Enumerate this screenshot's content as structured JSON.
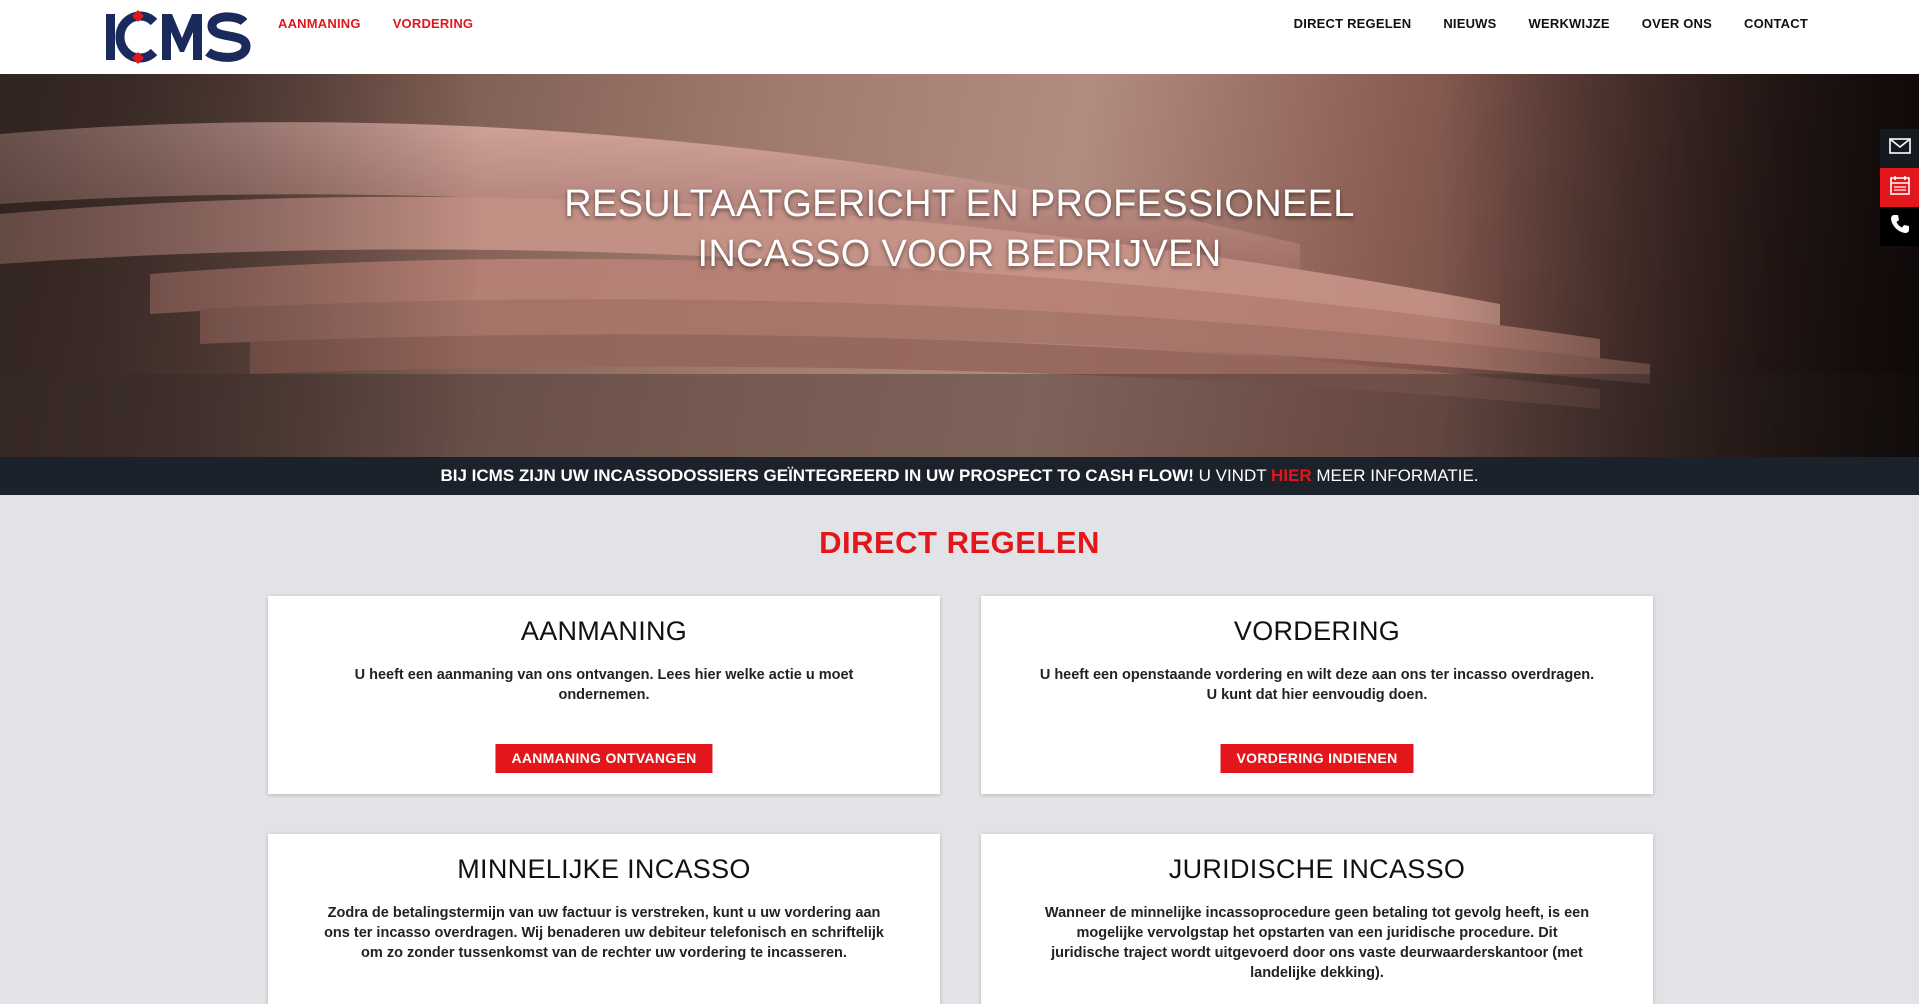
{
  "header": {
    "logo_text": "ICMS",
    "nav_left": [
      "AANMANING",
      "VORDERING"
    ],
    "nav_right": [
      "DIRECT REGELEN",
      "NIEUWS",
      "WERKWIJZE",
      "OVER ONS",
      "CONTACT"
    ]
  },
  "hero": {
    "title_line1": "RESULTAATGERICHT EN PROFESSIONEEL",
    "title_line2": "INCASSO VOOR BEDRIJVEN"
  },
  "side_widgets": [
    "mail-icon",
    "calendar-icon",
    "phone-icon"
  ],
  "banner": {
    "bold_text": "BIJ ICMS ZIJN UW INCASSODOSSIERS GEÏNTEGREERD IN UW PROSPECT TO CASH FLOW!",
    "text_before_link": " U VINDT ",
    "link_text": "HIER",
    "text_after_link": " MEER INFORMATIE."
  },
  "section": {
    "title": "DIRECT REGELEN",
    "cards": [
      {
        "title": "AANMANING",
        "text": "U heeft een aanmaning van ons ontvangen. Lees hier welke actie u moet ondernemen.",
        "button": "AANMANING ONTVANGEN"
      },
      {
        "title": "VORDERING",
        "text": "U heeft een openstaande vordering en wilt deze aan ons ter incasso overdragen. U kunt dat hier eenvoudig doen.",
        "button": "VORDERING INDIENEN"
      },
      {
        "title": "MINNELIJKE INCASSO",
        "text": "Zodra de betalingstermijn van uw factuur is verstreken, kunt u uw vordering aan ons ter incasso overdragen. Wij benaderen uw debiteur telefonisch en schriftelijk om zo zonder tussenkomst van de rechter uw vordering te incasseren."
      },
      {
        "title": "JURIDISCHE INCASSO",
        "text": "Wanneer de minnelijke incassoprocedure geen betaling tot gevolg heeft, is een mogelijke vervolgstap het opstarten van een juridische procedure. Dit juridische traject wordt uitgevoerd door ons vaste deurwaarderskantoor (met landelijke dekking)."
      }
    ]
  },
  "colors": {
    "accent_red": "#e3171b",
    "logo_navy": "#1b2a5c",
    "banner_bg": "#1c222b",
    "page_bg": "#e2e3e6"
  }
}
